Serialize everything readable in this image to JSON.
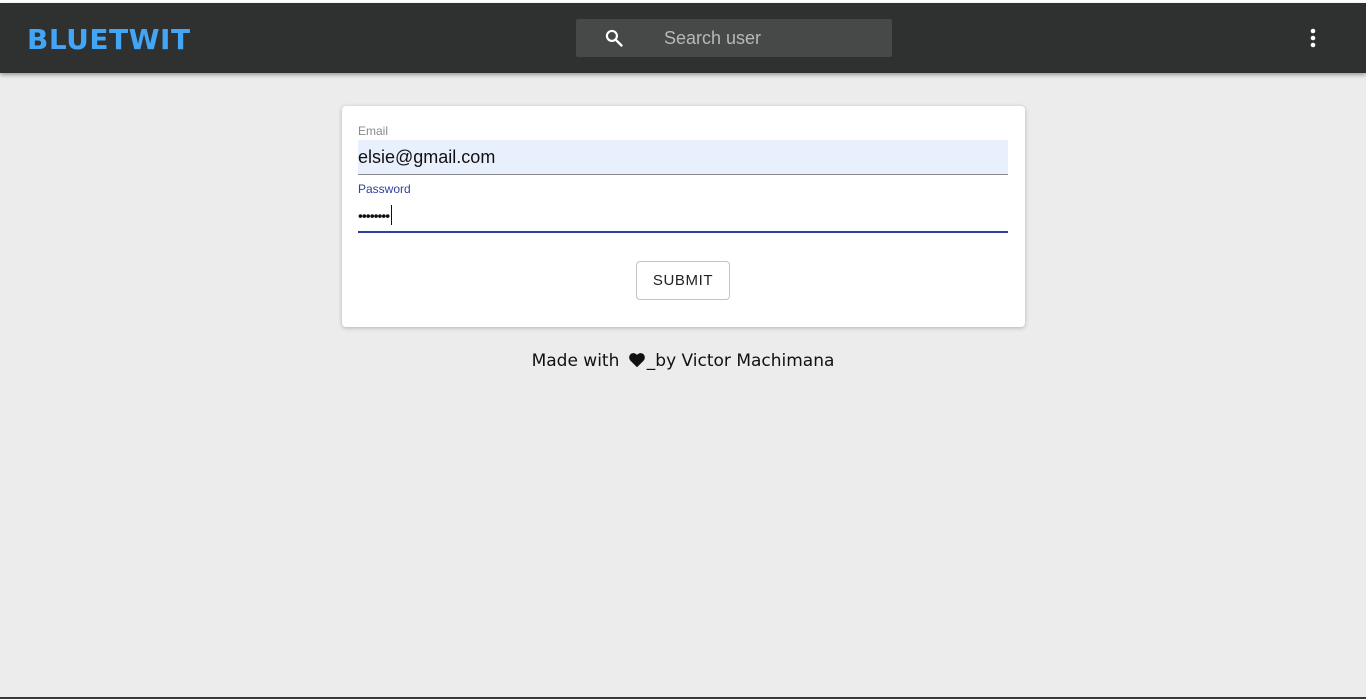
{
  "app": {
    "brand": "BLUETWIT",
    "brand_color": "#42a5f5",
    "appbar_color": "#2f3030"
  },
  "search": {
    "placeholder": "Search user",
    "icon": "search-icon"
  },
  "menu": {
    "icon": "more-vert-icon"
  },
  "login_form": {
    "email_label": "Email",
    "email_value": "elsie@gmail.com",
    "password_label": "Password",
    "password_masked": "••••••••",
    "submit_label": "SUBMIT",
    "focus_color": "#303f9f",
    "autofill_color": "#e8f0fe"
  },
  "footer": {
    "prefix": "Made with",
    "icon": "heart-icon",
    "suffix": "_by Victor Machimana"
  }
}
